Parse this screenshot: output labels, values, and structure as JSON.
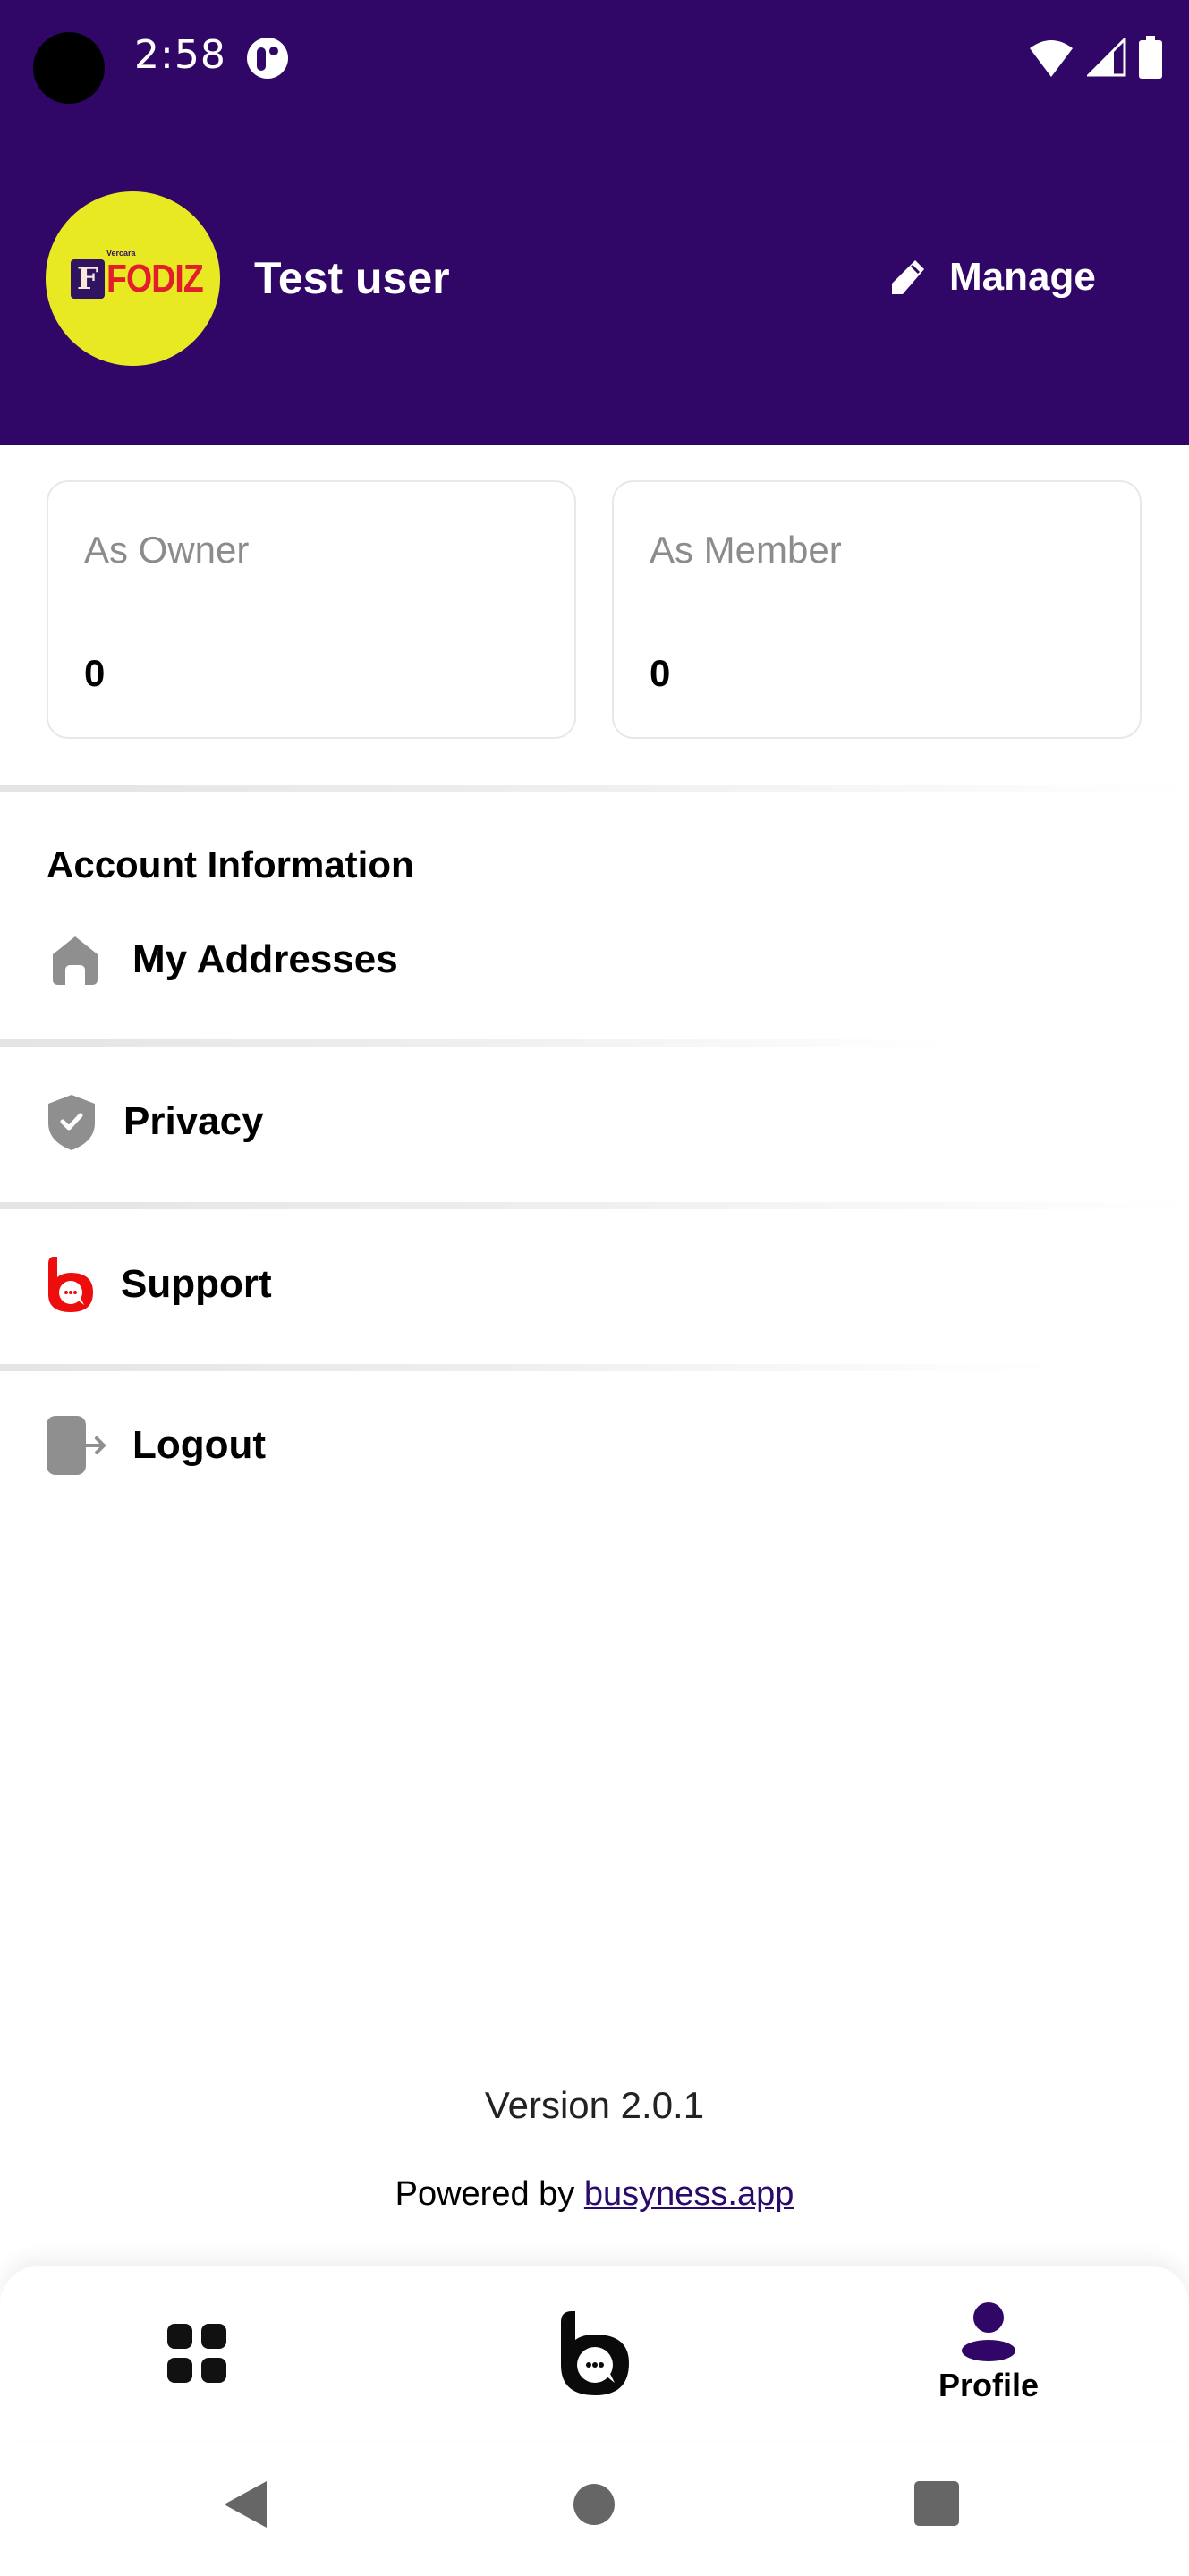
{
  "status_bar": {
    "time": "2:58",
    "icons": [
      "camera-cutout",
      "app-notification-icon",
      "wifi-icon",
      "signal-icon",
      "battery-icon"
    ]
  },
  "header": {
    "avatar": {
      "logo_letter": "F",
      "logo_word": "FODIZ",
      "logo_small_text": "Vercara"
    },
    "user_name": "Test user",
    "manage_label": "Manage",
    "manage_icon": "pencil-icon",
    "background_color": "#300766"
  },
  "stats": [
    {
      "label": "As Owner",
      "value": "0"
    },
    {
      "label": "As Member",
      "value": "0"
    }
  ],
  "account": {
    "section_title": "Account Information",
    "items": [
      {
        "label": "My Addresses",
        "icon": "home-icon"
      },
      {
        "label": "Privacy",
        "icon": "shield-check-icon"
      },
      {
        "label": "Support",
        "icon": "support-chat-icon"
      },
      {
        "label": "Logout",
        "icon": "logout-icon"
      }
    ]
  },
  "footer": {
    "version": "Version 2.0.1",
    "powered_by_prefix": "Powered by ",
    "powered_by_link": "busyness.app"
  },
  "bottom_nav": {
    "items": [
      {
        "label": "",
        "icon": "grid-icon",
        "active": false
      },
      {
        "label": "",
        "icon": "busyness-chat-icon",
        "active": false
      },
      {
        "label": "Profile",
        "icon": "person-icon",
        "active": true
      }
    ],
    "active_color": "#300766"
  },
  "system_nav": {
    "buttons": [
      "back",
      "home",
      "recents"
    ]
  }
}
